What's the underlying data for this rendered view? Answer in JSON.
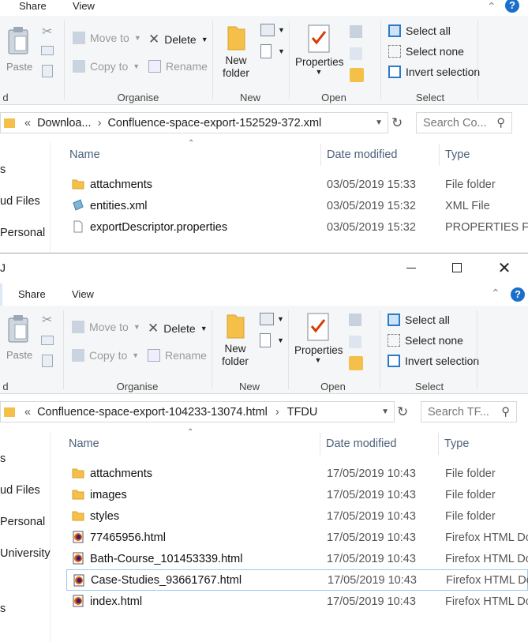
{
  "ribbon": {
    "tabs": [
      "Share",
      "View"
    ],
    "paste": "Paste",
    "move_to": "Move to",
    "copy_to": "Copy to",
    "delete": "Delete",
    "rename": "Rename",
    "new_folder_line1": "New",
    "new_folder_line2": "folder",
    "properties": "Properties",
    "select_all": "Select all",
    "select_none": "Select none",
    "invert_selection": "Invert selection",
    "groups": [
      "Organise",
      "New",
      "Open",
      "Select"
    ],
    "help": "?"
  },
  "columns": {
    "name": "Name",
    "date": "Date modified",
    "type": "Type"
  },
  "window1": {
    "address": [
      "Downloa...",
      "Confluence-space-export-152529-372.xml"
    ],
    "search_placeholder": "Search Co...",
    "nav": [
      "s",
      "ud Files",
      "Personal"
    ],
    "files": [
      {
        "name": "attachments",
        "date": "03/05/2019 15:33",
        "type": "File folder",
        "icon": "folder-icon"
      },
      {
        "name": "entities.xml",
        "date": "03/05/2019 15:32",
        "type": "XML File",
        "icon": "xml-file-icon"
      },
      {
        "name": "exportDescriptor.properties",
        "date": "03/05/2019 15:32",
        "type": "PROPERTIES Fil",
        "icon": "blank-file-icon"
      }
    ]
  },
  "window2": {
    "title": "J",
    "address": [
      "Confluence-space-export-104233-13074.html",
      "TFDU"
    ],
    "search_placeholder": "Search TF...",
    "nav": [
      "s",
      "ud Files",
      "Personal",
      "University",
      "s"
    ],
    "files": [
      {
        "name": "attachments",
        "date": "17/05/2019 10:43",
        "type": "File folder",
        "icon": "folder-icon"
      },
      {
        "name": "images",
        "date": "17/05/2019 10:43",
        "type": "File folder",
        "icon": "folder-icon"
      },
      {
        "name": "styles",
        "date": "17/05/2019 10:43",
        "type": "File folder",
        "icon": "folder-icon"
      },
      {
        "name": "77465956.html",
        "date": "17/05/2019 10:43",
        "type": "Firefox HTML Do",
        "icon": "firefox-html-icon"
      },
      {
        "name": "Bath-Course_101453339.html",
        "date": "17/05/2019 10:43",
        "type": "Firefox HTML Do",
        "icon": "firefox-html-icon"
      },
      {
        "name": "Case-Studies_93661767.html",
        "date": "17/05/2019 10:43",
        "type": "Firefox HTML Do",
        "icon": "firefox-html-icon",
        "selected": true
      },
      {
        "name": "index.html",
        "date": "17/05/2019 10:43",
        "type": "Firefox HTML Do",
        "icon": "firefox-html-icon"
      }
    ]
  },
  "colors": {
    "accent": "#1a6fc9",
    "folder": "#f5c04a",
    "selection_border": "#99c9ef"
  }
}
